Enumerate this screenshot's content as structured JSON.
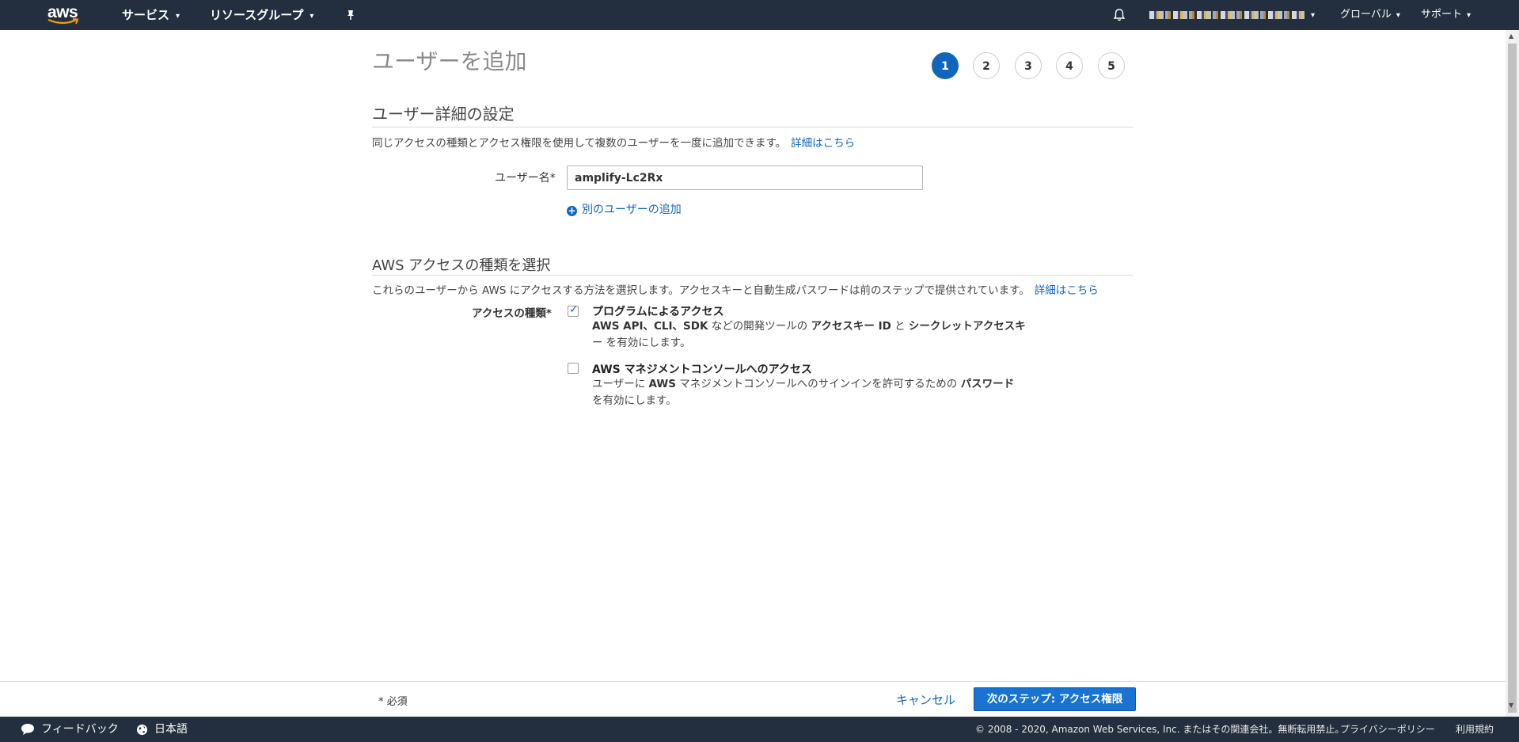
{
  "topnav": {
    "logo_text": "aws",
    "services": "サービス",
    "resource_groups": "リソースグループ",
    "region": "グローバル",
    "support": "サポート"
  },
  "page": {
    "title": "ユーザーを追加",
    "steps": [
      "1",
      "2",
      "3",
      "4",
      "5"
    ],
    "active_step": "1"
  },
  "user_details": {
    "heading": "ユーザー詳細の設定",
    "description": "同じアクセスの種類とアクセス権限を使用して複数のユーザーを一度に追加できます。",
    "learn_more": "詳細はこちら",
    "username_label": "ユーザー名*",
    "username_value": "amplify-Lc2Rx",
    "add_another": "別のユーザーの追加"
  },
  "access_type": {
    "heading": "AWS アクセスの種類を選択",
    "description": "これらのユーザーから AWS にアクセスする方法を選択します。アクセスキーと自動生成パスワードは前のステップで提供されています。",
    "learn_more": "詳細はこちら",
    "label": "アクセスの種類*",
    "programmatic": {
      "title": "プログラムによるアクセス",
      "checked": true,
      "desc_1": "AWS API、CLI、SDK",
      "desc_2": " などの開発ツールの ",
      "desc_3": "アクセスキー ID",
      "desc_4": " と ",
      "desc_5": "シークレットアクセスキ",
      "desc_6": "ー を有効にします。"
    },
    "console": {
      "title": "AWS マネジメントコンソールへのアクセス",
      "checked": false,
      "desc_1": "ユーザーに ",
      "desc_2": "AWS",
      "desc_3": " マネジメントコンソールへのサインインを許可するための ",
      "desc_4": "パスワード",
      "desc_5": "を有効にします。"
    }
  },
  "actions": {
    "required_note": "* 必須",
    "cancel": "キャンセル",
    "next": "次のステップ: アクセス権限"
  },
  "footer": {
    "feedback": "フィードバック",
    "language": "日本語",
    "copyright": "© 2008 - 2020, Amazon Web Services, Inc. またはその関連会社。無断転用禁止。",
    "privacy": "プライバシーポリシー",
    "terms": "利用規約"
  },
  "colors": {
    "nav_bg": "#232f3e",
    "accent": "#1166bb",
    "primary_button": "#1873d3"
  }
}
